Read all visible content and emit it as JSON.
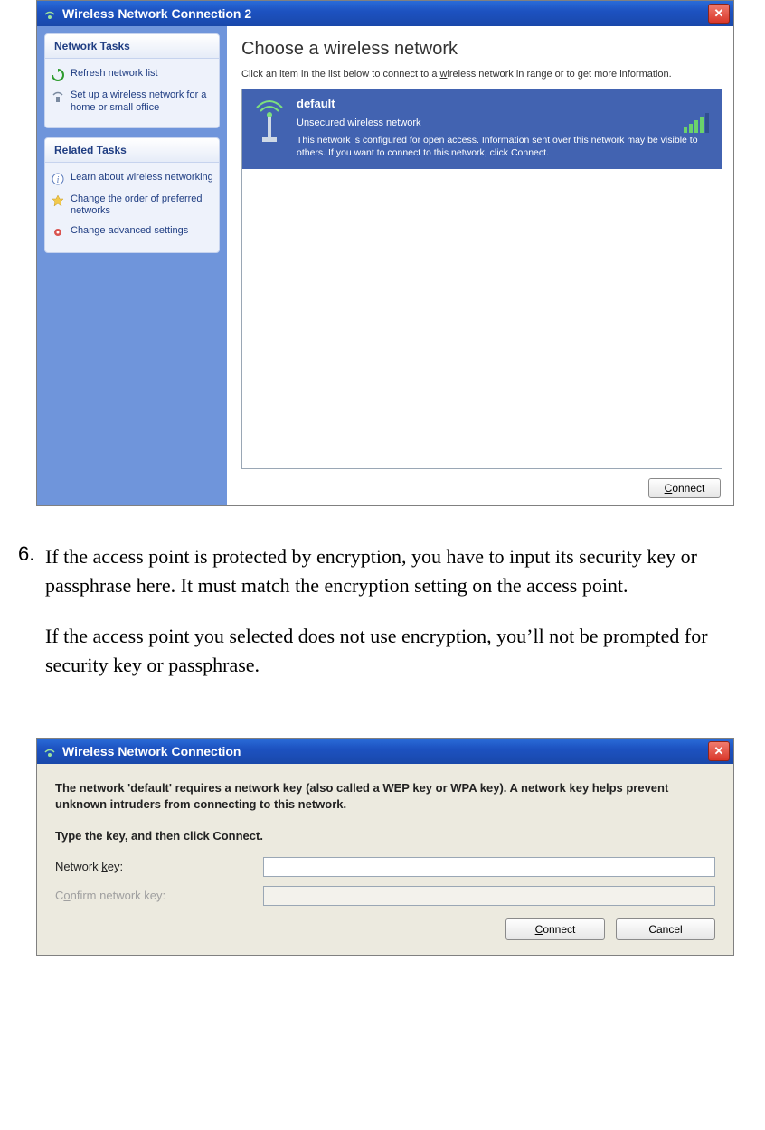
{
  "window1": {
    "title": "Wireless Network Connection 2",
    "sidebar": {
      "panel1": {
        "header": "Network Tasks",
        "items": [
          {
            "label": "Refresh network list"
          },
          {
            "label": "Set up a wireless network for a home or small office"
          }
        ]
      },
      "panel2": {
        "header": "Related Tasks",
        "items": [
          {
            "label": "Learn about wireless networking"
          },
          {
            "label": "Change the order of preferred networks"
          },
          {
            "label": "Change advanced settings"
          }
        ]
      }
    },
    "content": {
      "heading": "Choose a wireless network",
      "desc_pre": "Click an item in the list below to connect to a ",
      "desc_u": "w",
      "desc_post": "ireless network in range or to get more information.",
      "network": {
        "name": "default",
        "subtitle": "Unsecured wireless network",
        "info": "This network is configured for open access. Information sent over this network may be visible to others. If you want to connect to this network, click Connect."
      },
      "connect_u": "C",
      "connect_rest": "onnect"
    }
  },
  "step": {
    "num": "6.",
    "para1": "If the access point is protected by encryption, you have to input its security key or passphrase here. It must match the encryption setting on the access point.",
    "para2": "If the access point you selected does not use encryption, you’ll not be prompted for security key or passphrase."
  },
  "window2": {
    "title": "Wireless Network Connection",
    "intro": "The network 'default' requires a network key (also called a WEP key or WPA key). A network key helps prevent unknown intruders from connecting to this network.",
    "instr": "Type the key, and then click Connect.",
    "label_key_pre": "Network ",
    "label_key_u": "k",
    "label_key_post": "ey:",
    "label_confirm_pre": "C",
    "label_confirm_u": "o",
    "label_confirm_post": "nfirm network key:",
    "value_key": "",
    "connect_u": "C",
    "connect_rest": "onnect",
    "cancel": "Cancel"
  }
}
